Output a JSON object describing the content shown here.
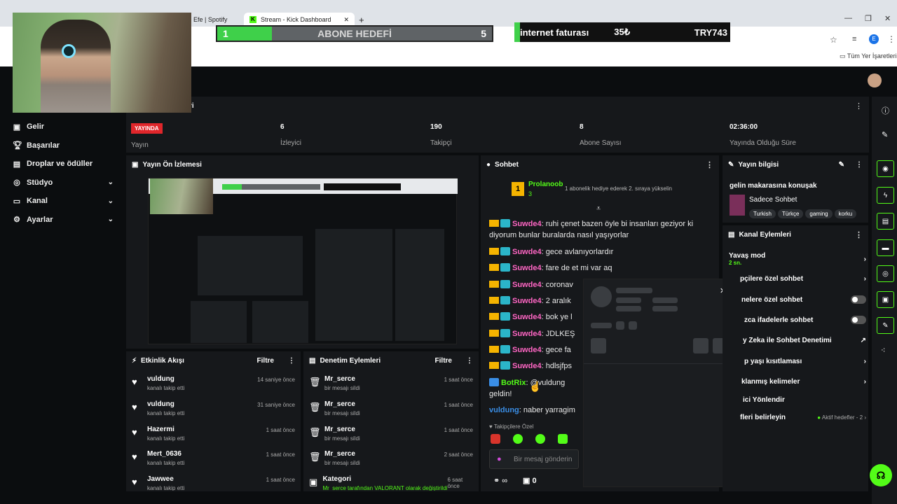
{
  "browser": {
    "tab_spotify": "Efe | Spotify",
    "tab_active": "Stream - Kick Dashboard",
    "bookmarks_label": "Tüm Yer İşaretleri",
    "profile_letter": "E"
  },
  "overlay": {
    "goal_start": "1",
    "goal_title": "ABONE HEDEFİ",
    "goal_end": "5",
    "goal_progress": 0.2,
    "bill_name": "internet faturası",
    "bill_amount": "35₺",
    "bill_code": "TRY743"
  },
  "header": {
    "section_title_suffix": "ri"
  },
  "nav": [
    {
      "icon": "income-icon",
      "label": "Gelir"
    },
    {
      "icon": "trophy-icon",
      "label": "Başarılar"
    },
    {
      "icon": "gift-icon",
      "label": "Droplar ve ödüller"
    },
    {
      "icon": "studio-icon",
      "label": "Stüdyo"
    },
    {
      "icon": "channel-icon",
      "label": "Kanal"
    },
    {
      "icon": "settings-icon",
      "label": "Ayarlar"
    }
  ],
  "stats": {
    "live_badge": "YAYINDA",
    "live_label": "Yayın",
    "viewers_value": "6",
    "viewers_label": "İzleyici",
    "followers_value": "190",
    "followers_label": "Takipçi",
    "subs_value": "8",
    "subs_label": "Abone Sayısı",
    "uptime_value": "02:36:00",
    "uptime_label": "Yayında Olduğu Süre"
  },
  "preview": {
    "title": "Yayın Ön İzlemesi"
  },
  "activity": {
    "title": "Etkinlik Akışı",
    "filter": "Filtre",
    "rows": [
      {
        "name": "vuldung",
        "sub": "kanalı takip etti",
        "time": "14 saniye önce"
      },
      {
        "name": "vuldung",
        "sub": "kanalı takip etti",
        "time": "31 saniye önce"
      },
      {
        "name": "Hazermi",
        "sub": "kanalı takip etti",
        "time": "1 saat önce"
      },
      {
        "name": "Mert_0636",
        "sub": "kanalı takip etti",
        "time": "1 saat önce"
      },
      {
        "name": "Jawwee",
        "sub": "kanalı takip etti",
        "time": "1 saat önce"
      }
    ]
  },
  "moderation": {
    "title": "Denetim Eylemleri",
    "filter": "Filtre",
    "rows": [
      {
        "name": "Mr_serce",
        "sub": "bir mesajı sildi",
        "time": "1 saat önce"
      },
      {
        "name": "Mr_serce",
        "sub": "bir mesajı sildi",
        "time": "1 saat önce"
      },
      {
        "name": "Mr_serce",
        "sub": "bir mesajı sildi",
        "time": "1 saat önce"
      },
      {
        "name": "Mr_serce",
        "sub": "bir mesajı sildi",
        "time": "2 saat önce"
      },
      {
        "name": "Kategori",
        "sub": "Mr_serce tarafından VALORANT olarak değiştirildi",
        "time": "6 saat önce"
      }
    ]
  },
  "chat": {
    "title": "Sohbet",
    "pinned_user": "Prolanoob",
    "pinned_count": "3",
    "pinned_rank": "1",
    "pinned_text": "1 abonelik hediye ederek 2. sıraya yükselin",
    "messages": [
      {
        "user": "Suwde4",
        "text": "ruhi çenet bazen öyle bi insanları geziyor ki"
      },
      {
        "user": "",
        "text": "diyorum bunlar buralarda nasıl yaşıyorlar"
      },
      {
        "user": "Suwde4",
        "text": "gece avlanıyorlardır"
      },
      {
        "user": "Suwde4",
        "text": "fare de et mi var aq"
      },
      {
        "user": "Suwde4",
        "text": "coronav"
      },
      {
        "user": "Suwde4",
        "text": "2 aralık"
      },
      {
        "user": "Suwde4",
        "text": "bok ye l"
      },
      {
        "user": "Suwde4",
        "text": "JDLKEŞ"
      },
      {
        "user": "Suwde4",
        "text": "gece fa"
      },
      {
        "user": "Suwde4",
        "text": "hdlsjfps"
      },
      {
        "user": "BotRix",
        "text": "@vuldung"
      },
      {
        "user": "",
        "text": "geldin!"
      },
      {
        "user": "vuldung",
        "text": "naber yarragim"
      }
    ],
    "followers_only": "Takipçilere Özel",
    "input_placeholder": "Bir mesaj gönderin",
    "points": "0"
  },
  "stream_info": {
    "title": "Yayın bilgisi",
    "stream_title": "gelin makarasına konuşak",
    "category": "Sadece Sohbet",
    "tags": [
      "Turkish",
      "Türkçe",
      "gaming",
      "korku"
    ]
  },
  "channel_actions": {
    "title": "Kanal Eylemleri",
    "slow_mode": "Yavaş mod",
    "slow_mode_value": "2 sn.",
    "items": [
      "pçilere özel sohbet",
      "nelere özel sohbet",
      "zca ifadelerle sohbet",
      "y Zeka ile Sohbet Denetimi",
      "p yaşı kısıtlaması",
      "klanmış kelimeler",
      "ici Yönlendir",
      "fleri belirleyin"
    ],
    "active_goals": "Aktif hedefler - 2"
  }
}
